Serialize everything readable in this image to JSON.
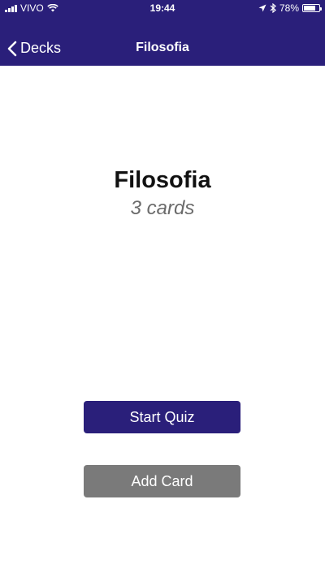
{
  "status_bar": {
    "carrier": "VIVO",
    "time": "19:44",
    "battery_percent": "78%",
    "battery_level": 0.78,
    "icons": [
      "signal-icon",
      "wifi-icon",
      "location-icon",
      "bluetooth-icon",
      "battery-icon"
    ]
  },
  "navbar": {
    "back_label": "Decks",
    "title": "Filosofia"
  },
  "deck": {
    "title": "Filosofia",
    "card_count": "3 cards"
  },
  "actions": {
    "start_quiz_label": "Start Quiz",
    "add_card_label": "Add Card"
  },
  "colors": {
    "primary": "#2a1f7a",
    "secondary_button": "#7a7a7a",
    "background": "#ffffff",
    "title_text": "#111111",
    "subtitle_text": "#6b6b6b"
  }
}
